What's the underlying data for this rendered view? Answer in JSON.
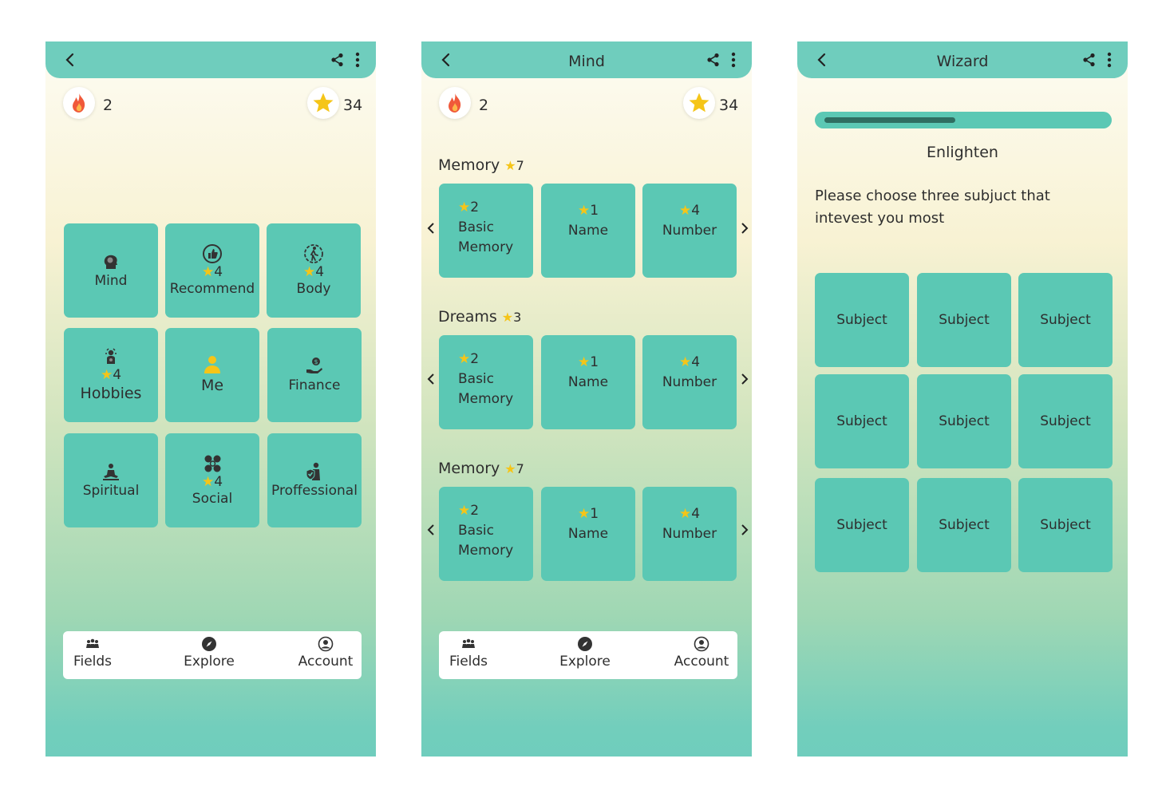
{
  "stats": {
    "streak": "2",
    "stars": "34"
  },
  "fields": {
    "tiles": [
      {
        "label": "Mind",
        "stars": "",
        "icon": "head-brain-icon"
      },
      {
        "label": "Recommend",
        "stars": "4",
        "icon": "thumbs-up-icon"
      },
      {
        "label": "Body",
        "stars": "4",
        "icon": "walking-person-icon"
      },
      {
        "label": "Hobbies",
        "stars": "4",
        "icon": "artist-icon"
      },
      {
        "label": "Me",
        "stars": "",
        "icon": "person-icon"
      },
      {
        "label": "Finance",
        "stars": "",
        "icon": "hand-money-icon"
      },
      {
        "label": "Spiritual",
        "stars": "",
        "icon": "meditation-icon"
      },
      {
        "label": "Social",
        "stars": "4",
        "icon": "people-network-icon"
      },
      {
        "label": "Proffessional",
        "stars": "",
        "icon": "worker-shield-icon"
      }
    ]
  },
  "nav": {
    "fields": "Fields",
    "explore": "Explore",
    "account": "Account"
  },
  "mind": {
    "title": "Mind",
    "sections": [
      {
        "title": "Memory",
        "stars": "7",
        "tiles": [
          {
            "stars": "2",
            "line1": "Basic",
            "line2": "Memory"
          },
          {
            "stars": "1",
            "line1": "Name"
          },
          {
            "stars": "4",
            "line1": "Number"
          }
        ]
      },
      {
        "title": "Dreams",
        "stars": "3",
        "tiles": [
          {
            "stars": "2",
            "line1": "Basic",
            "line2": "Memory"
          },
          {
            "stars": "1",
            "line1": "Name"
          },
          {
            "stars": "4",
            "line1": "Number"
          }
        ]
      },
      {
        "title": "Memory",
        "stars": "7",
        "tiles": [
          {
            "stars": "2",
            "line1": "Basic",
            "line2": "Memory"
          },
          {
            "stars": "1",
            "line1": "Name"
          },
          {
            "stars": "4",
            "line1": "Number"
          }
        ]
      }
    ]
  },
  "wizard": {
    "title": "Wizard",
    "progress": 0.47,
    "heading": "Enlighten",
    "question": "Please choose three subjuct that intevest you most",
    "subjects": [
      "Subject",
      "Subject",
      "Subject",
      "Subject",
      "Subject",
      "Subject",
      "Subject",
      "Subject",
      "Subject"
    ]
  },
  "colors": {
    "teal": "#6fcdbd",
    "tile": "#5bc8b4",
    "star": "#f5c518",
    "progress_fill": "#2f6e61"
  }
}
